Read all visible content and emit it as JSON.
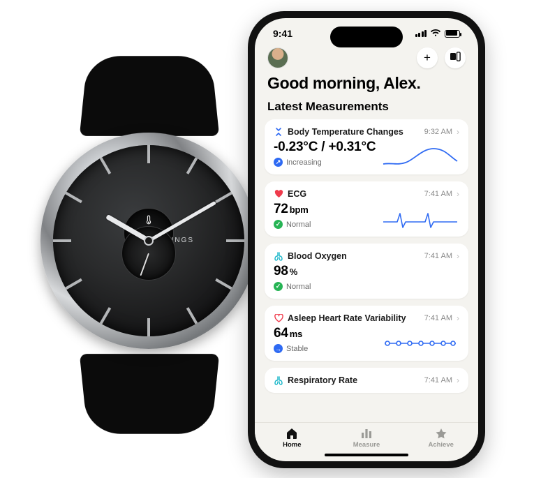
{
  "watch": {
    "brand": "WITHINGS",
    "subdial_label": "Temp"
  },
  "statusbar": {
    "time": "9:41"
  },
  "header": {
    "greeting": "Good morning, Alex.",
    "section_title": "Latest Measurements"
  },
  "cards": {
    "temp": {
      "title": "Body Temperature Changes",
      "time": "9:32 AM",
      "value": "-0.23°C / +0.31°C",
      "status": "Increasing"
    },
    "ecg": {
      "title": "ECG",
      "time": "7:41 AM",
      "value": "72",
      "unit": "bpm",
      "status": "Normal"
    },
    "spo2": {
      "title": "Blood Oxygen",
      "time": "7:41 AM",
      "value": "98",
      "unit": "%",
      "status": "Normal"
    },
    "hrv": {
      "title": "Asleep Heart Rate Variability",
      "time": "7:41 AM",
      "value": "64",
      "unit": "ms",
      "status": "Stable"
    },
    "resp": {
      "title": "Respiratory Rate",
      "time": "7:41 AM"
    }
  },
  "tabs": {
    "home": "Home",
    "measure": "Measure",
    "achieve": "Achieve"
  }
}
